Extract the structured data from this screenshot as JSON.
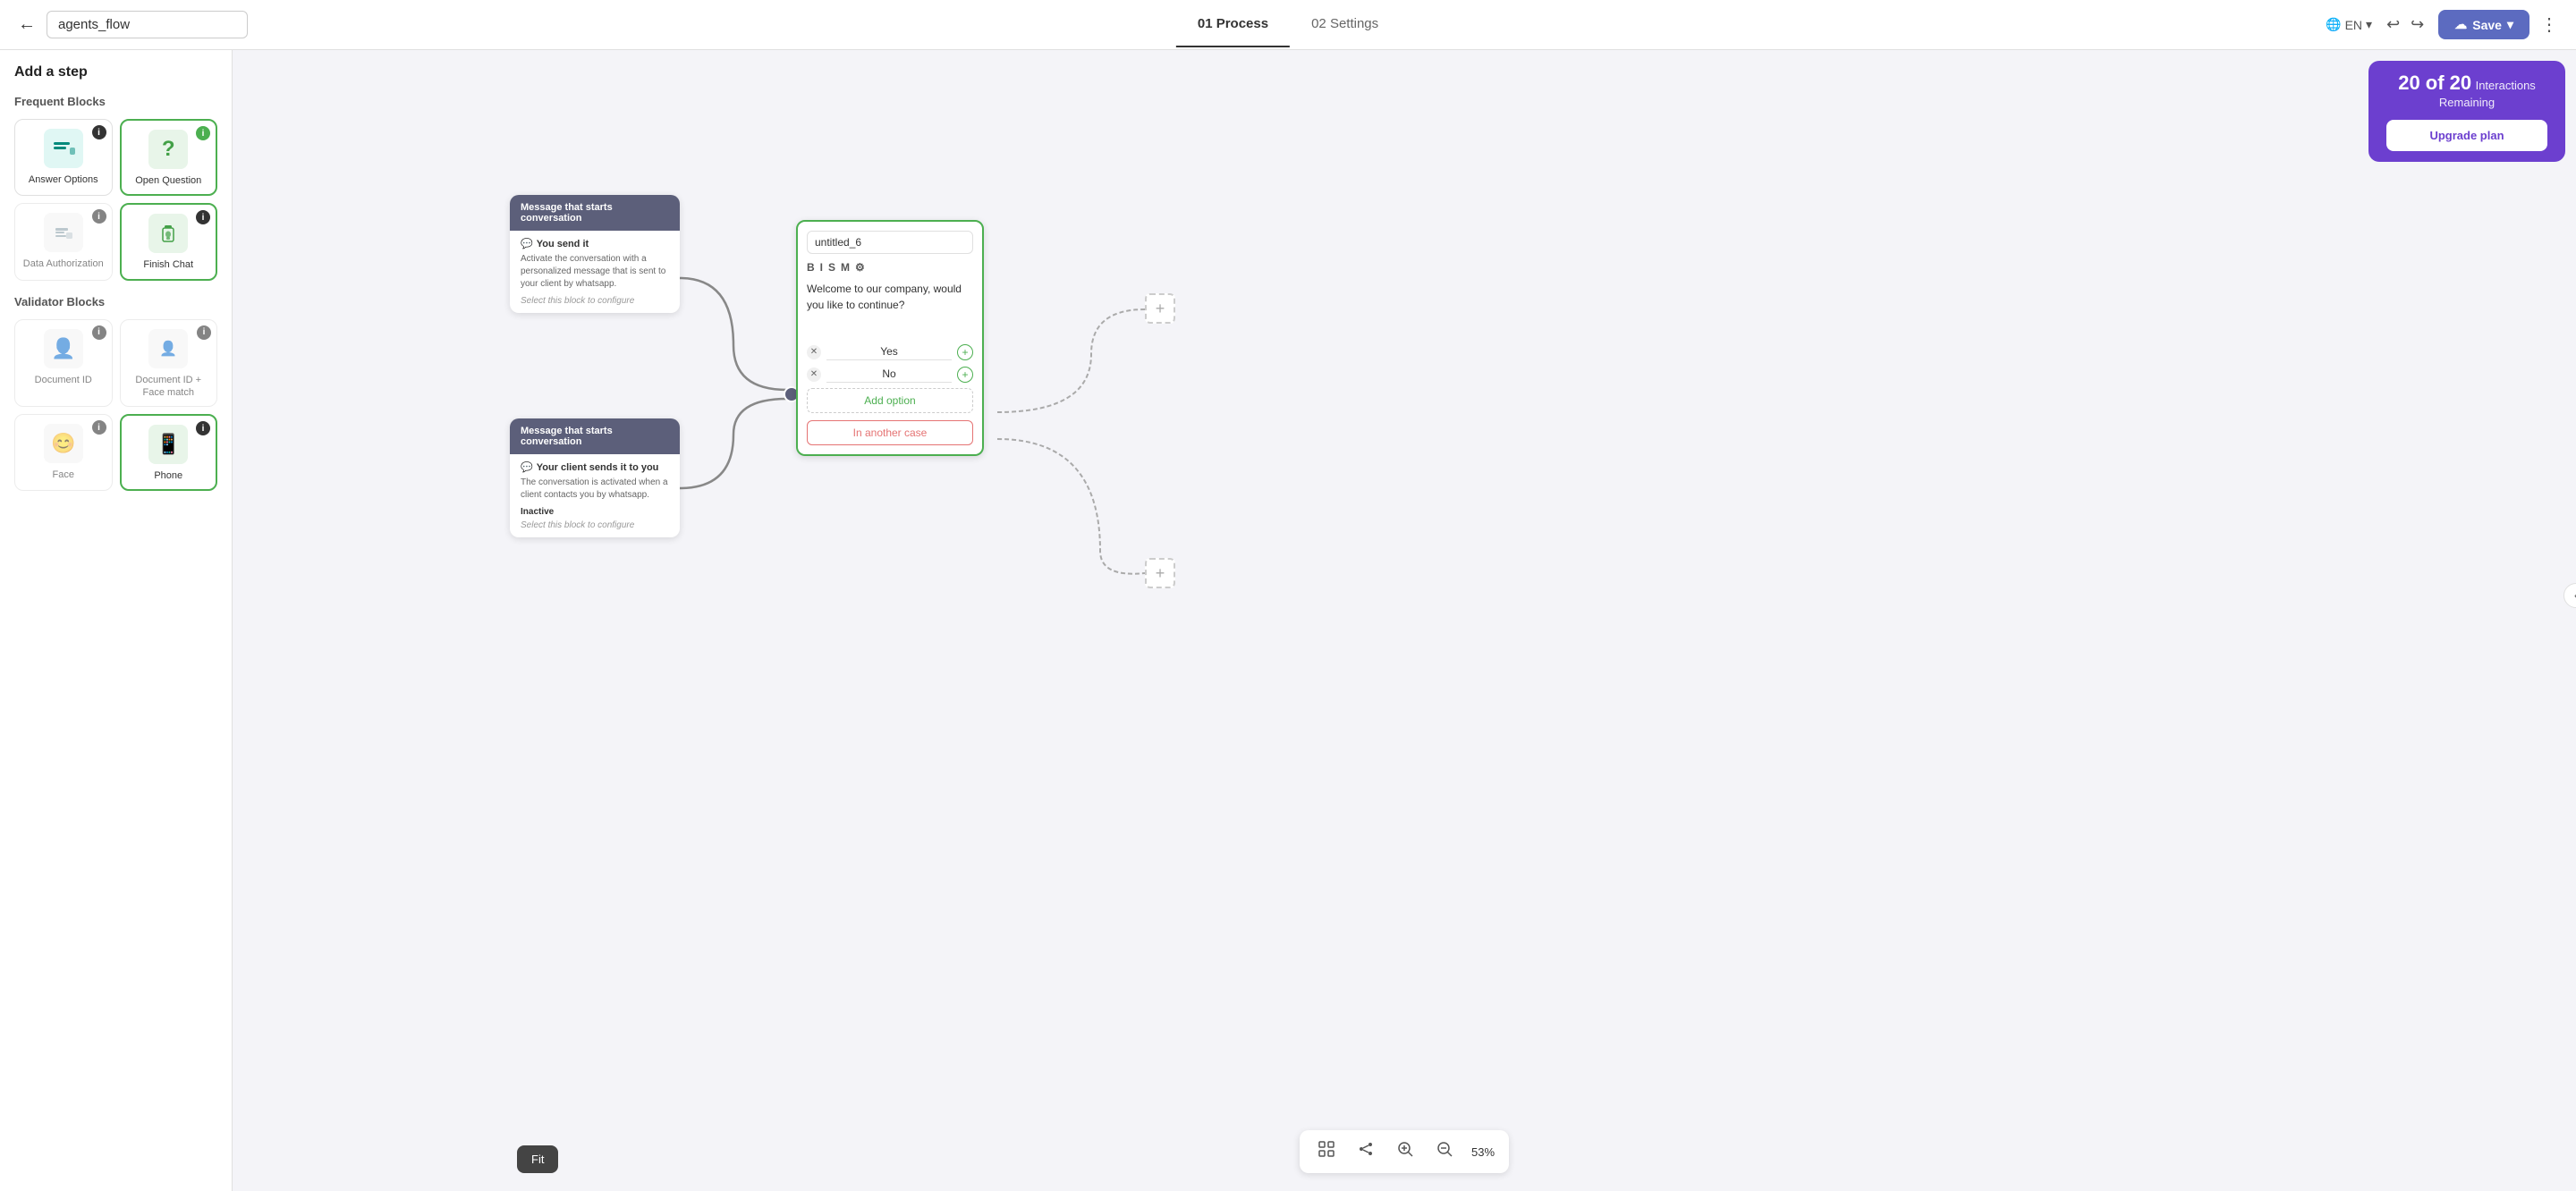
{
  "header": {
    "back_label": "←",
    "title": "agents_flow",
    "tabs": [
      {
        "label": "01 Process",
        "active": true
      },
      {
        "label": "02 Settings",
        "active": false
      }
    ],
    "lang": "EN",
    "save_label": "Save",
    "more_label": "⋮"
  },
  "sidebar": {
    "title": "Add a step",
    "frequent_blocks_label": "Frequent Blocks",
    "validator_blocks_label": "Validator Blocks",
    "frequent_blocks": [
      {
        "label": "Answer Options",
        "icon": "☰",
        "icon_style": "teal",
        "info": "i",
        "info_color": "dark"
      },
      {
        "label": "Open Question",
        "icon": "?",
        "icon_style": "green",
        "info": "i",
        "info_color": "green",
        "green_border": true
      },
      {
        "label": "Data Authorization",
        "icon": "☑",
        "icon_style": "gray",
        "info": "i",
        "info_color": "dark"
      },
      {
        "label": "Finish Chat",
        "icon": "🔒",
        "icon_style": "green",
        "info": "i",
        "info_color": "dark",
        "green_border": true
      }
    ],
    "validator_blocks": [
      {
        "label": "Document ID",
        "icon": "👤",
        "icon_style": "gray",
        "info": "i"
      },
      {
        "label": "Document ID + Face match",
        "icon": "👤",
        "icon_style": "gray",
        "info": "i"
      },
      {
        "label": "Face",
        "icon": "😊",
        "icon_style": "gray",
        "info": "i"
      },
      {
        "label": "Phone",
        "icon": "📱",
        "icon_style": "green",
        "info": "i",
        "green_border": true
      }
    ]
  },
  "canvas": {
    "fit_label": "Fit",
    "zoom_pct": "53%",
    "zoom_in_icon": "🔍+",
    "zoom_out_icon": "🔍-"
  },
  "interactions": {
    "count": "20 of 20",
    "label": "Interactions\nRemaining",
    "upgrade_label": "Upgrade plan"
  },
  "nodes": {
    "start_message_top": {
      "header": "Message that starts conversation",
      "send_label": "You send it",
      "description": "Activate the conversation with a personalized message that is sent to your client by whatsapp.",
      "config_text": "Select this block to configure"
    },
    "start_message_bottom": {
      "header": "Message that starts conversation",
      "send_label": "Your client sends it to you",
      "description": "The conversation is activated when a client contacts you by whatsapp.",
      "inactive_label": "Inactive",
      "config_text": "Select this block to configure"
    },
    "open_question": {
      "name": "untitled_6",
      "toolbar_items": [
        "B",
        "I",
        "S",
        "M",
        "⚙"
      ],
      "content": "Welcome to our company, would you like to continue?",
      "options": [
        {
          "label": "Yes"
        },
        {
          "label": "No"
        }
      ],
      "add_option_label": "Add option",
      "another_case_label": "In another case"
    }
  }
}
